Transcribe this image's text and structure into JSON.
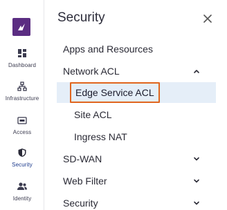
{
  "rail": {
    "items": [
      {
        "label": "Dashboard",
        "icon": "dashboard-icon"
      },
      {
        "label": "Infrastructure",
        "icon": "infrastructure-icon"
      },
      {
        "label": "Access",
        "icon": "access-icon"
      },
      {
        "label": "Security",
        "icon": "shield-icon",
        "active": true
      },
      {
        "label": "Identity",
        "icon": "identity-icon"
      }
    ]
  },
  "panel": {
    "title": "Security",
    "menu": [
      {
        "label": "Apps and Resources"
      },
      {
        "label": "Network ACL",
        "expanded": true
      },
      {
        "label": "Edge Service ACL",
        "selected": true
      },
      {
        "label": "Site ACL"
      },
      {
        "label": "Ingress NAT"
      },
      {
        "label": "SD-WAN",
        "expanded": false
      },
      {
        "label": "Web Filter",
        "expanded": false
      },
      {
        "label": "Security",
        "expanded": false
      }
    ]
  },
  "colors": {
    "brand": "#5b2d82",
    "selected_bg": "#e5eef8",
    "highlight_border": "#e0651d",
    "active_nav": "#1b3a8c"
  }
}
